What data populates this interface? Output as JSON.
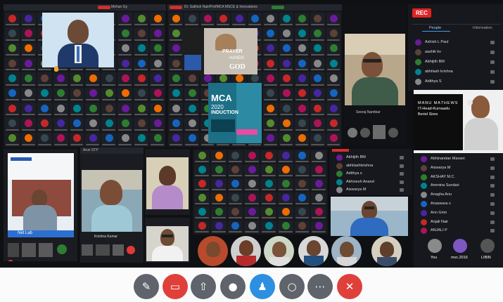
{
  "top_left": {
    "rec_tag": "REC",
    "name_strip": "Mohan Gy"
  },
  "top_mid": {
    "title": "Dr. Sathish Nair/ProfMCA MSCE & Innovations"
  },
  "poster_prayer": {
    "line1": "PRAYER",
    "line2": "HANDS",
    "line3": "GOD"
  },
  "poster_mca": {
    "title": "MCA",
    "year": "2020",
    "sub": "INDUCTION"
  },
  "webcam_tr": {
    "name": "Seeraj Nambiar"
  },
  "right_panel": {
    "rec_label": "REC",
    "tabs": [
      "People",
      "Information"
    ],
    "participants_top": [
      "Ashish L Paul",
      "aashik kv",
      "Abhijith BM",
      "abhilash krishna",
      "Adithya S"
    ],
    "participants_bottom": [
      "Abhinandan Mavani",
      "Aiswarya M",
      "AKSHAY M.C.",
      "Ammina Sundari",
      "Anagha Anu",
      "Anaswara s",
      "Ann Grim",
      "Anjali Nair",
      "ANJALI P"
    ]
  },
  "presenter_card": {
    "line1": "MANU MATHEWS",
    "line2": "IT-Head-Kurnaadu",
    "line3": "Beriel Siree"
  },
  "mid_list": [
    "Abhijith BM",
    "abhilashkrishna",
    "Adithya s",
    "Akhinesh Anand",
    "Aiswarya M"
  ],
  "net_lab": {
    "label": "Net Lab"
  },
  "small_panel": {
    "title": "Arun STP",
    "name": "Krishna Kumar"
  },
  "bottom_right": {
    "labels": [
      "You",
      "mvc.2016",
      "LIBIN"
    ]
  },
  "controls": [
    {
      "name": "mic-toggle-button",
      "icon": "microphone-off-icon",
      "glyph": "✎",
      "color": "grey"
    },
    {
      "name": "camera-toggle-button",
      "icon": "camera-off-icon",
      "glyph": "▭",
      "color": "red"
    },
    {
      "name": "share-screen-button",
      "icon": "share-screen-icon",
      "glyph": "⇧",
      "color": "grey"
    },
    {
      "name": "record-button",
      "icon": "record-icon",
      "glyph": "●",
      "color": "grey"
    },
    {
      "name": "participants-button",
      "icon": "person-icon",
      "glyph": "♟",
      "color": "blue"
    },
    {
      "name": "chat-button",
      "icon": "chat-bubble-icon",
      "glyph": "○",
      "color": "grey"
    },
    {
      "name": "more-options-button",
      "icon": "more-dots-icon",
      "glyph": "⋯",
      "color": "grey"
    },
    {
      "name": "end-call-button",
      "icon": "close-icon",
      "glyph": "✕",
      "color": "red"
    }
  ]
}
